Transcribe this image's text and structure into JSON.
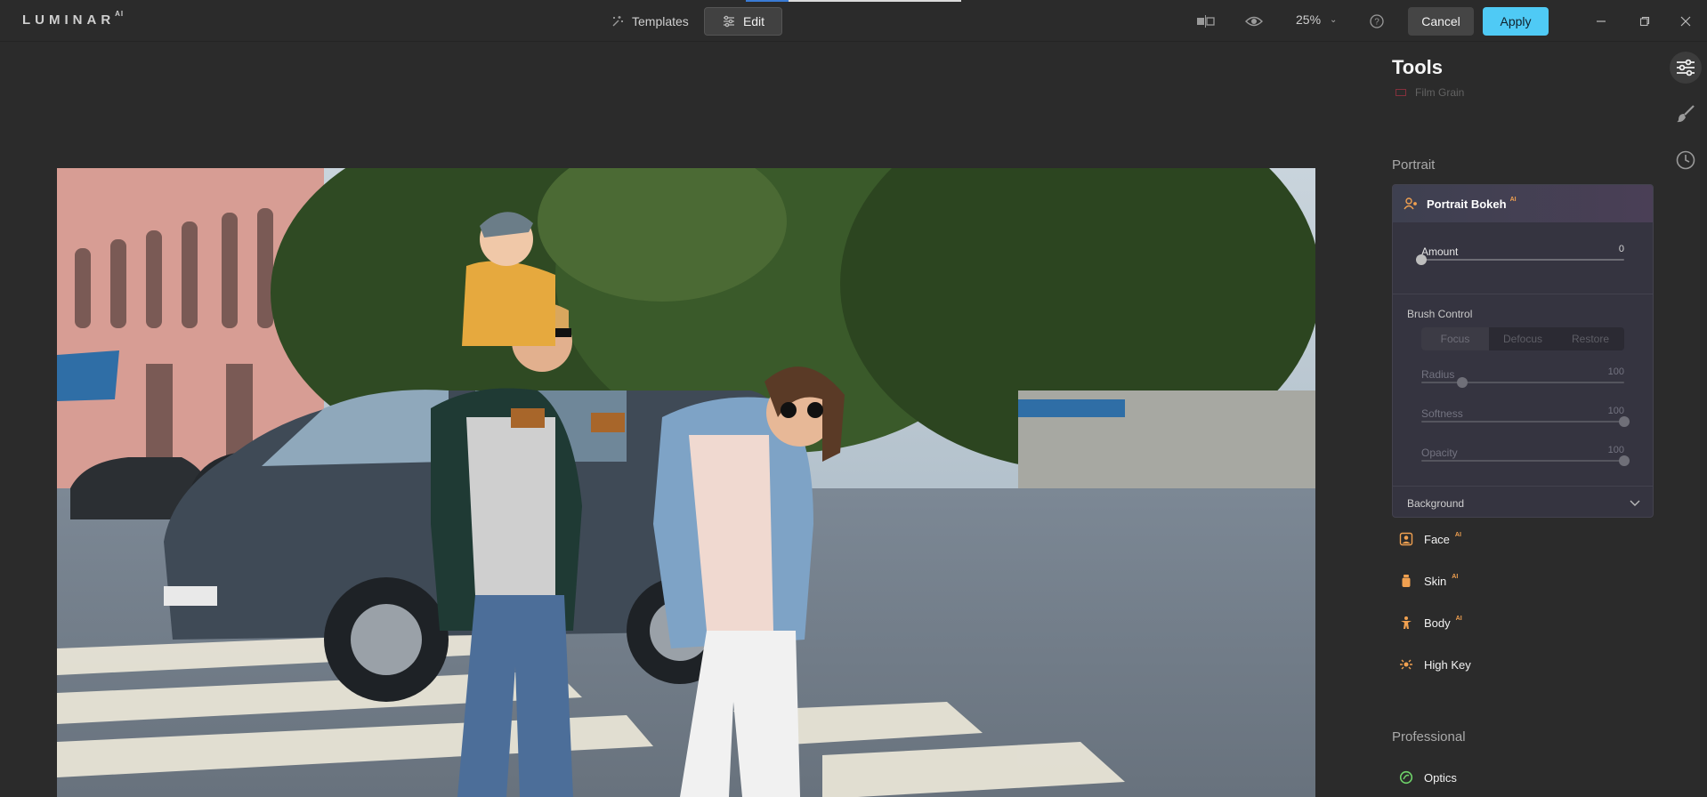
{
  "app": {
    "logo_text": "LUMINAR",
    "logo_suffix": "AI"
  },
  "topbar": {
    "tabs": [
      {
        "label": "Templates"
      },
      {
        "label": "Edit"
      }
    ],
    "zoom": "25%",
    "cancel_label": "Cancel",
    "apply_label": "Apply"
  },
  "panel": {
    "title": "Tools",
    "faded_item": "Film Grain",
    "portrait_section": "Portrait",
    "portrait_bokeh": {
      "title": "Portrait Bokeh",
      "ai_badge": "AI",
      "amount": {
        "label": "Amount",
        "value": "0"
      },
      "brush_control": "Brush Control",
      "modes": [
        "Focus",
        "Defocus",
        "Restore"
      ],
      "radius": {
        "label": "Radius",
        "value": "100",
        "level": 0.2
      },
      "softness": {
        "label": "Softness",
        "value": "100",
        "level": 1.0
      },
      "opacity": {
        "label": "Opacity",
        "value": "100",
        "level": 1.0
      },
      "background_label": "Background"
    },
    "tools": [
      {
        "label": "Face",
        "ai": "AI"
      },
      {
        "label": "Skin",
        "ai": "AI"
      },
      {
        "label": "Body",
        "ai": "AI"
      },
      {
        "label": "High Key",
        "ai": ""
      }
    ],
    "professional_section": "Professional",
    "optics": "Optics"
  },
  "colors": {
    "apply": "#4fcaf5",
    "accent_orange": "#f0a050",
    "optics_green": "#6fd36a"
  },
  "icons": [
    "templates-icon",
    "edit-sliders-icon",
    "compare-icon",
    "preview-eye-icon",
    "help-icon",
    "minimize-icon",
    "restore-icon",
    "close-icon",
    "tools-sliders-icon",
    "brush-icon",
    "history-clock-icon"
  ]
}
